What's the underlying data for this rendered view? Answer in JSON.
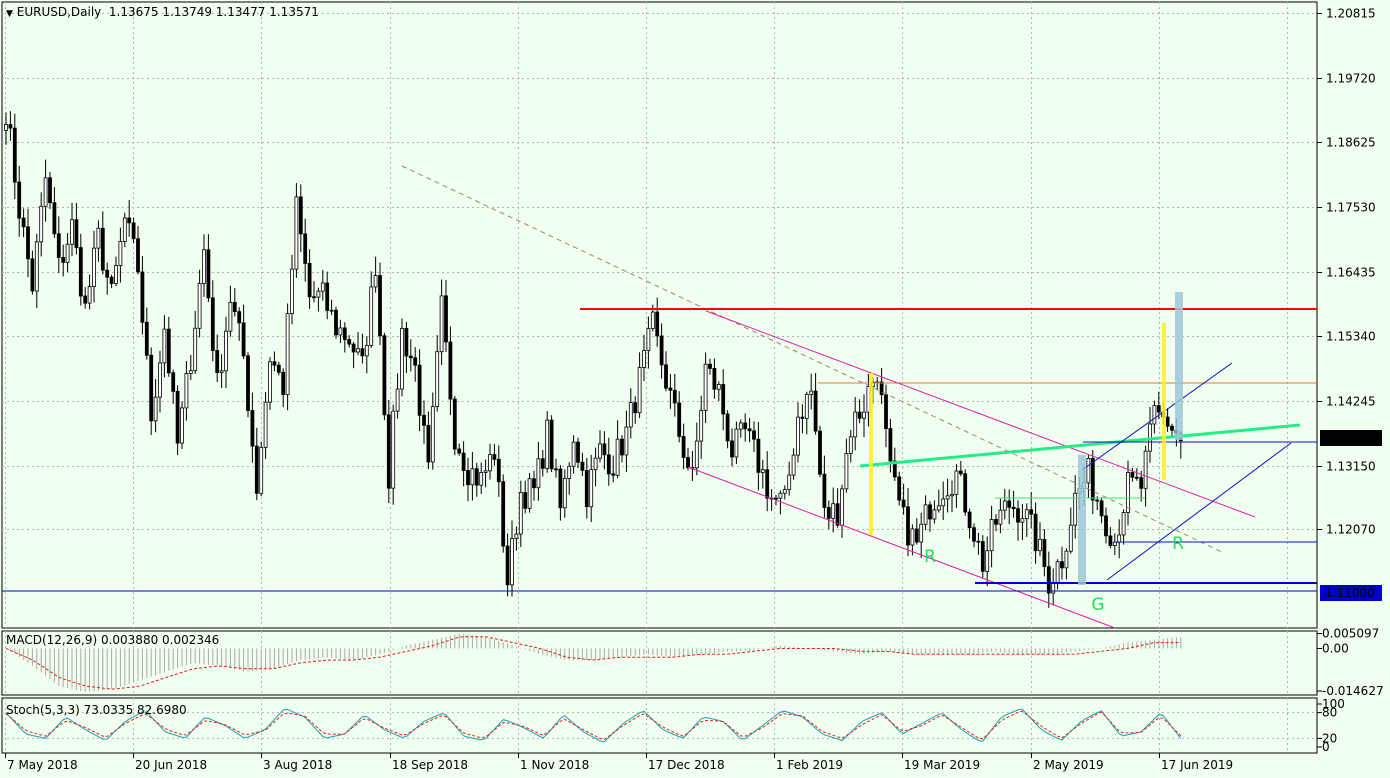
{
  "main_header": {
    "symbol_timeframe": "EURUSD,Daily",
    "ohlc": "1.13675 1.13749 1.13477 1.13571"
  },
  "macd_header": {
    "text": "MACD(12,26,9) 0.003880 0.002346"
  },
  "stoch_header": {
    "text": "Stoch(5,3,3) 73.0335 82.6980"
  },
  "chart_data": [
    {
      "type": "candlestick",
      "title": "EURUSD,Daily",
      "ylim": [
        1.104,
        1.21
      ],
      "x": [
        "7 May 2018",
        "20 Jun 2018",
        "3 Aug 2018",
        "18 Sep 2018",
        "1 Nov 2018",
        "17 Dec 2018",
        "1 Feb 2019",
        "19 Mar 2019",
        "2 May 2019",
        "17 Jun 2019"
      ],
      "y_ticks": [
        "1.20815",
        "1.19720",
        "1.18625",
        "1.17530",
        "1.16435",
        "1.15340",
        "1.14245",
        "1.13150",
        "1.12070"
      ],
      "current_price": "1.13571",
      "current_price_color": "#000000",
      "support_level": "1.11000",
      "support_level_color": "#0000cd",
      "resistance_level": 1.1575,
      "annotations": [
        "R",
        "R",
        "G"
      ],
      "path": [
        1.192,
        1.175,
        1.162,
        1.18,
        1.165,
        1.172,
        1.158,
        1.17,
        1.16,
        1.173,
        1.165,
        1.14,
        1.155,
        1.135,
        1.15,
        1.168,
        1.145,
        1.16,
        1.15,
        1.128,
        1.15,
        1.145,
        1.175,
        1.16,
        1.16,
        1.155,
        1.153,
        1.148,
        1.166,
        1.13,
        1.154,
        1.148,
        1.13,
        1.158,
        1.137,
        1.131,
        1.129,
        1.134,
        1.112,
        1.127,
        1.127,
        1.137,
        1.124,
        1.137,
        1.127,
        1.134,
        1.132,
        1.137,
        1.146,
        1.155,
        1.146,
        1.137,
        1.129,
        1.148,
        1.144,
        1.134,
        1.137,
        1.132,
        1.126,
        1.125,
        1.14,
        1.144,
        1.123,
        1.124,
        1.138,
        1.142,
        1.148,
        1.13,
        1.122,
        1.118,
        1.125,
        1.128,
        1.13,
        1.123,
        1.115,
        1.122,
        1.125,
        1.124,
        1.119,
        1.112,
        1.116,
        1.126,
        1.13,
        1.124,
        1.119,
        1.128,
        1.128,
        1.14,
        1.139,
        1.136
      ],
      "colors": {
        "bull": "#ffffff",
        "bear": "#000000",
        "wick": "#000000"
      }
    },
    {
      "type": "histogram",
      "title": "MACD(12,26,9) 0.003880 0.002346",
      "y_ticks": [
        "0.005097",
        "0.00",
        "-0.014627"
      ],
      "series": [
        {
          "name": "MACD",
          "values": [
            0.0,
            -0.006,
            -0.013,
            -0.015,
            -0.014,
            -0.011,
            -0.008,
            -0.005,
            -0.006,
            -0.008,
            -0.007,
            -0.004,
            -0.003,
            -0.004,
            -0.002,
            0.001,
            0.003,
            0.005,
            0.004,
            0.001,
            -0.002,
            -0.004,
            -0.004,
            -0.003,
            -0.002,
            -0.003,
            -0.002,
            -0.001,
            -0.001,
            0.001,
            0.0,
            -0.001,
            -0.002,
            -0.001,
            -0.002,
            -0.002,
            -0.002,
            -0.001,
            -0.002,
            -0.002,
            -0.001,
            0.0,
            0.002,
            0.003,
            0.004
          ]
        },
        {
          "name": "Signal",
          "values": [
            0.0,
            -0.004,
            -0.01,
            -0.013,
            -0.014,
            -0.013,
            -0.01,
            -0.007,
            -0.006,
            -0.007,
            -0.007,
            -0.005,
            -0.004,
            -0.004,
            -0.003,
            -0.001,
            0.001,
            0.004,
            0.004,
            0.002,
            0.0,
            -0.003,
            -0.004,
            -0.003,
            -0.003,
            -0.003,
            -0.002,
            -0.002,
            -0.001,
            0.0,
            0.0,
            0.0,
            -0.001,
            -0.001,
            -0.002,
            -0.002,
            -0.002,
            -0.002,
            -0.002,
            -0.002,
            -0.002,
            -0.001,
            0.0,
            0.002,
            0.002
          ]
        }
      ]
    },
    {
      "type": "line",
      "title": "Stoch(5,3,3) 73.0335 82.6980",
      "ylim": [
        0,
        100
      ],
      "y_ticks": [
        "100",
        "80",
        "20",
        "0"
      ],
      "series": [
        {
          "name": "Main",
          "values": [
            80,
            30,
            20,
            70,
            40,
            15,
            60,
            85,
            35,
            20,
            70,
            50,
            20,
            40,
            90,
            70,
            20,
            30,
            75,
            40,
            20,
            60,
            80,
            25,
            15,
            65,
            45,
            20,
            75,
            35,
            10,
            55,
            85,
            40,
            20,
            70,
            60,
            15,
            50,
            85,
            70,
            30,
            15,
            60,
            80,
            30,
            55,
            80,
            40,
            10,
            70,
            90,
            40,
            15,
            60,
            85,
            25,
            35,
            80,
            20
          ]
        },
        {
          "name": "Signal",
          "values": [
            78,
            38,
            25,
            62,
            45,
            22,
            55,
            78,
            42,
            26,
            62,
            52,
            28,
            38,
            80,
            72,
            30,
            30,
            68,
            44,
            26,
            55,
            75,
            32,
            20,
            58,
            48,
            26,
            66,
            40,
            16,
            50,
            78,
            46,
            24,
            62,
            60,
            22,
            45,
            78,
            72,
            36,
            20,
            52,
            76,
            36,
            50,
            75,
            45,
            16,
            62,
            85,
            48,
            20,
            55,
            82,
            32,
            34,
            72,
            26
          ]
        }
      ]
    }
  ]
}
